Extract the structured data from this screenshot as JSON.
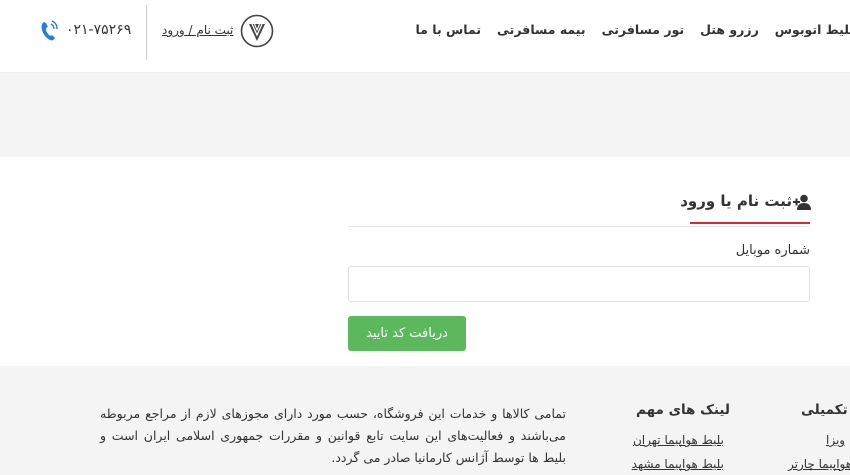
{
  "nav": {
    "items": [
      "بلیط اتوبوس",
      "رزرو هتل",
      "تور مسافرتی",
      "بیمه مسافرتی",
      "تماس با ما"
    ]
  },
  "header": {
    "login_label": "ثبت نام / ورود",
    "phone": "۰۲۱-۷۵۲۶۹",
    "logo_icon": "brand-logo-icon",
    "phone_icon": "phone-icon"
  },
  "form": {
    "title": "ثبت نام یا ورود",
    "title_icon": "user-plus-icon",
    "mobile_label": "شماره موبایل",
    "mobile_value": "",
    "submit_label": "دریافت کد تایید",
    "accent_color": "#d9272e",
    "button_color": "#5cb85c"
  },
  "footer": {
    "about_text": "تمامی کالاها و خدمات این فروشگاه، حسب مورد دارای مجوزهای لازم از مراجع مربوطه می‌باشند و فعالیت‌های این سایت تابع قوانین و مقررات جمهوری اسلامی ایران است و بلیط ها توسط آژانس کارمانیا صادر می گردد.",
    "links_title": "لینک های مهم",
    "links": [
      "بلیط هواپیما تهران",
      "بلیط هواپیما مشهد"
    ],
    "extra_title": "تکمیلی",
    "extra_links": [
      "ویزا",
      "بلیط هواپیما چارتر"
    ]
  }
}
